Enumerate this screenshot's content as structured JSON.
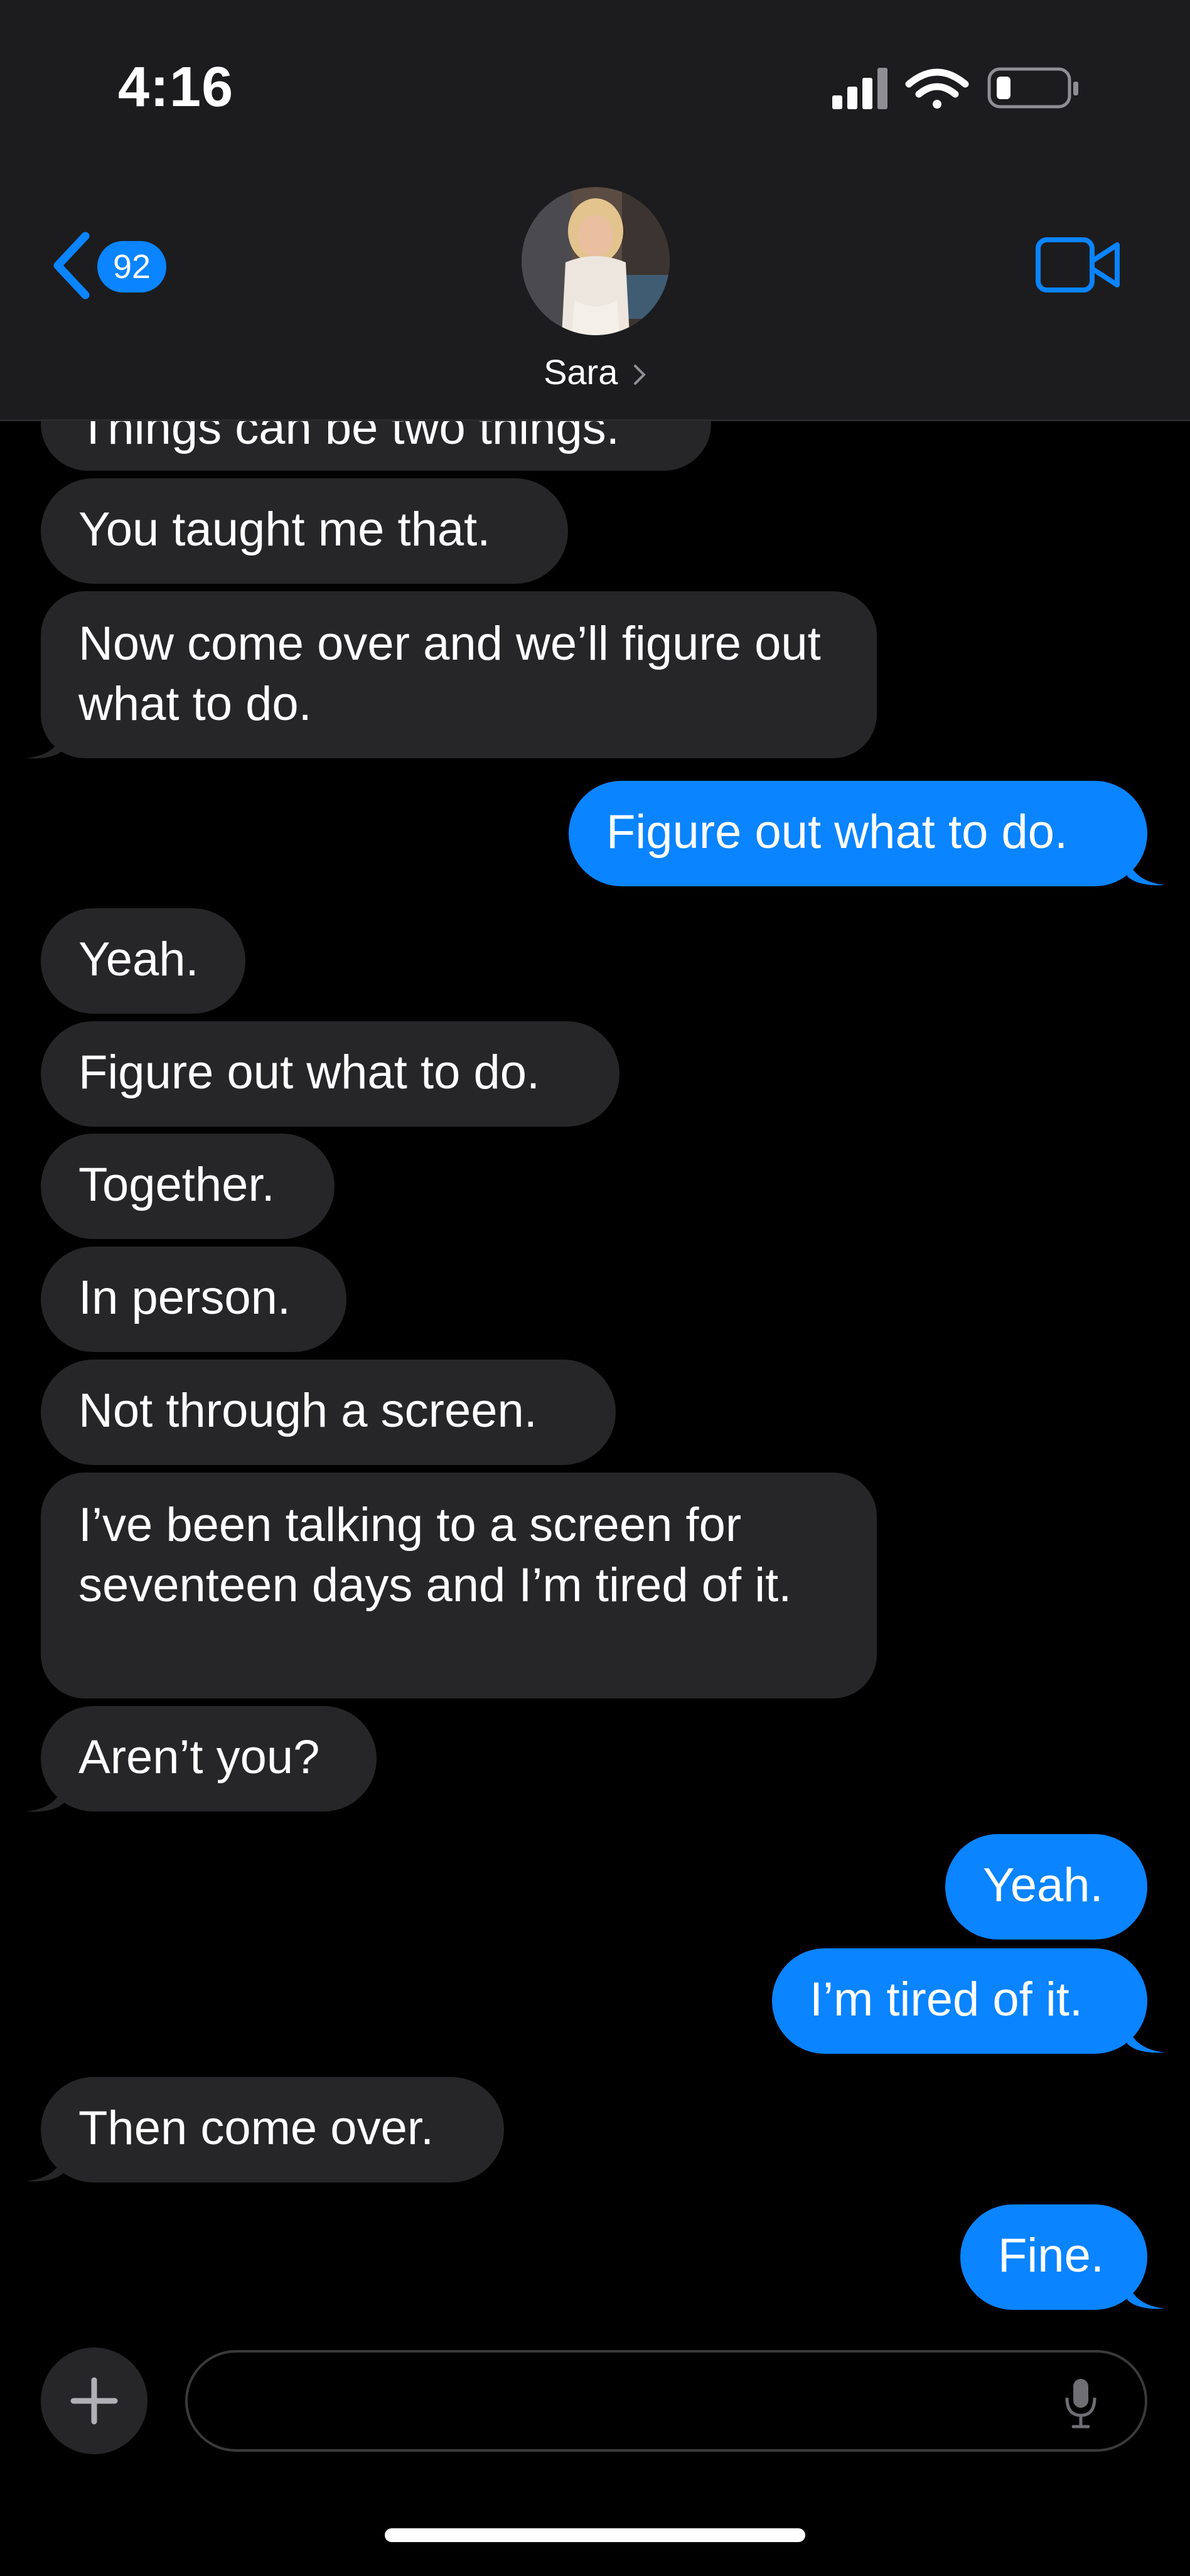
{
  "status_bar": {
    "time": "4:16"
  },
  "header": {
    "unread_count": "92",
    "contact_name": "Sara"
  },
  "messages": [
    {
      "from": "them",
      "text": "Things can be two things."
    },
    {
      "from": "them",
      "text": "You taught me that."
    },
    {
      "from": "them",
      "text": "Now come over and we’ll figure out what to do."
    },
    {
      "from": "me",
      "text": "Figure out what to do."
    },
    {
      "from": "them",
      "text": "Yeah."
    },
    {
      "from": "them",
      "text": "Figure out what to do."
    },
    {
      "from": "them",
      "text": "Together."
    },
    {
      "from": "them",
      "text": "In person."
    },
    {
      "from": "them",
      "text": "Not through a screen."
    },
    {
      "from": "them",
      "text": "I’ve been talking to a screen for seventeen days and I’m tired of it."
    },
    {
      "from": "them",
      "text": "Aren’t you?"
    },
    {
      "from": "me",
      "text": "Yeah."
    },
    {
      "from": "me",
      "text": "I’m tired of it."
    },
    {
      "from": "them",
      "text": "Then come over."
    },
    {
      "from": "me",
      "text": "Fine."
    }
  ],
  "composer": {
    "placeholder": ""
  },
  "colors": {
    "accent": "#0A84FF",
    "incoming_bubble": "#262628",
    "background": "#000000",
    "header_bg": "#1C1C1E"
  },
  "icons": [
    "back-chevron-icon",
    "video-camera-icon",
    "plus-icon",
    "microphone-icon",
    "signal-icon",
    "wifi-icon",
    "battery-icon"
  ]
}
